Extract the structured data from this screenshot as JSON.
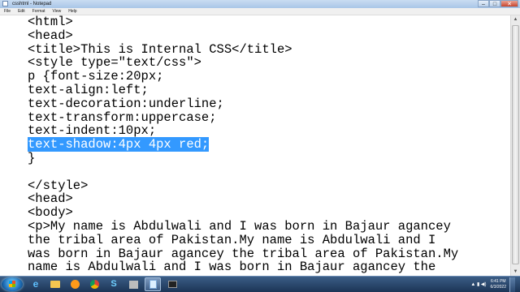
{
  "window": {
    "title": "csshtml - Notepad",
    "controls": {
      "minimize": "–",
      "maximize": "□",
      "close": "✕"
    }
  },
  "menu": [
    "File",
    "Edit",
    "Format",
    "View",
    "Help"
  ],
  "editor": {
    "lines": [
      {
        "text": "<html>",
        "selected": false
      },
      {
        "text": "<head>",
        "selected": false
      },
      {
        "text": "<title>This is Internal CSS</title>",
        "selected": false
      },
      {
        "text": "<style type=\"text/css\">",
        "selected": false
      },
      {
        "text": "p {font-size:20px;",
        "selected": false
      },
      {
        "text": "text-align:left;",
        "selected": false
      },
      {
        "text": "text-decoration:underline;",
        "selected": false
      },
      {
        "text": "text-transform:uppercase;",
        "selected": false
      },
      {
        "text": "text-indent:10px;",
        "selected": false
      },
      {
        "text": "text-shadow:4px 4px red;",
        "selected": true
      },
      {
        "text": "}",
        "selected": false
      },
      {
        "text": "",
        "selected": false
      },
      {
        "text": "</style>",
        "selected": false
      },
      {
        "text": "<head>",
        "selected": false
      },
      {
        "text": "<body>",
        "selected": false
      },
      {
        "text": "<p>My name is Abdulwali and I was born in Bajaur agancey",
        "selected": false
      },
      {
        "text": "the tribal area of Pakistan.My name is Abdulwali and I",
        "selected": false
      },
      {
        "text": "was born in Bajaur agancey the tribal area of Pakistan.My",
        "selected": false
      },
      {
        "text": "name is Abdulwali and I was born in Bajaur agancey the",
        "selected": false
      }
    ]
  },
  "taskbar": {
    "apps": [
      {
        "name": "internet-explorer-icon",
        "glyph": "e",
        "active": false
      },
      {
        "name": "folder-icon",
        "glyph": "",
        "active": false
      },
      {
        "name": "media-player-icon",
        "glyph": "",
        "active": false
      },
      {
        "name": "chrome-icon",
        "glyph": "",
        "active": false
      },
      {
        "name": "skype-icon",
        "glyph": "S",
        "active": false
      },
      {
        "name": "app-icon",
        "glyph": "",
        "active": false
      },
      {
        "name": "notepad-icon",
        "glyph": "",
        "active": true
      },
      {
        "name": "recorder-icon",
        "glyph": "",
        "active": false
      }
    ],
    "tray_symbols": "▲ ▮ ◀)",
    "clock": {
      "time": "6:41 PM",
      "date": "6/3/2022"
    }
  },
  "colors": {
    "selection": "#3399ff",
    "taskbar": "#1c3556"
  }
}
